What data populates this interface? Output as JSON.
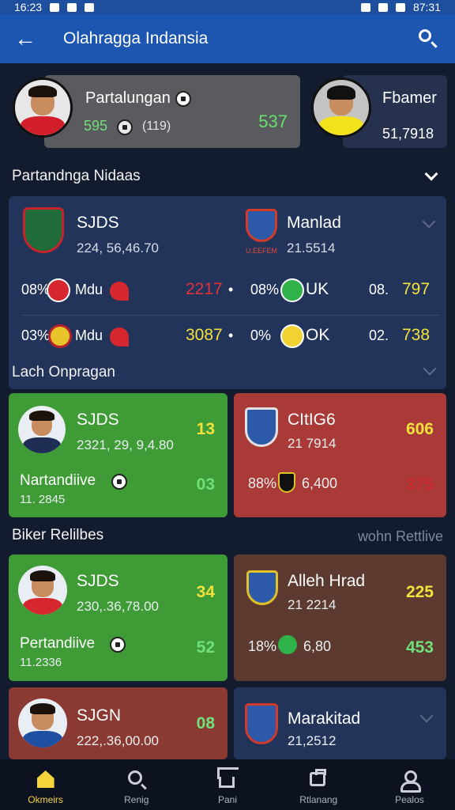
{
  "status": {
    "time": "16:23",
    "right": "87:31"
  },
  "appbar": {
    "title": "Olahragga Indansia"
  },
  "top": {
    "left_name": "Partalungan",
    "left_sub": "595",
    "left_sub2": "(119)",
    "left_score": "537",
    "right_name": "Fbamer",
    "right_val": "51,7918"
  },
  "section1": {
    "title": "Partandnga Nidaas"
  },
  "big": {
    "team1": "SJDS",
    "team1_sub": "224, 56,46.70",
    "team2": "Manlad",
    "team2_sub": "21.5514",
    "crest2_caption": "U.EEFEM",
    "rows": [
      {
        "pct": "08%",
        "name": "Mdu",
        "val": "2217",
        "pct2": "08%",
        "code": "UK",
        "num": "08.",
        "score": "797"
      },
      {
        "pct": "03%",
        "name": "Mdu",
        "val": "3087",
        "pct2": "0%",
        "code": "OK",
        "num": "02.",
        "score": "738"
      }
    ]
  },
  "section2": {
    "title": "Lach Onpragan"
  },
  "tiles1": {
    "a": {
      "title": "SJDS",
      "sub": "2321, 29, 9,4.80",
      "num": "13",
      "label": "Nartandiive",
      "label_sub": "11. 2845",
      "num2": "03"
    },
    "b": {
      "title": "CItIG6",
      "sub": "21 7914",
      "num": "606",
      "pct": "88%",
      "val": "6,400",
      "num2": "375"
    }
  },
  "section3": {
    "title": "Biker Relilbes",
    "right": "wohn Rettlive"
  },
  "tiles2": {
    "a": {
      "title": "SJDS",
      "sub": "230,.36,78.00",
      "num": "34",
      "label": "Pertandiive",
      "label_sub": "11.2336",
      "num2": "52"
    },
    "b": {
      "title": "Alleh Hrad",
      "sub": "21 2214",
      "num": "225",
      "pct": "18%",
      "val": "6,80",
      "num2": "453"
    }
  },
  "tiles3": {
    "a": {
      "title": "SJGN",
      "sub": "222,.36,00.00",
      "num": "08"
    },
    "b": {
      "title": "Marakitad",
      "sub": "21,2512"
    }
  },
  "nav": {
    "items": [
      "Okmeirs",
      "Renig",
      "Pani",
      "Rtlanang",
      "Pealos"
    ]
  },
  "colors": {
    "accent": "#1d56b0",
    "active": "#f5d33a",
    "green": "#3f9b36",
    "red": "#a93a37"
  }
}
